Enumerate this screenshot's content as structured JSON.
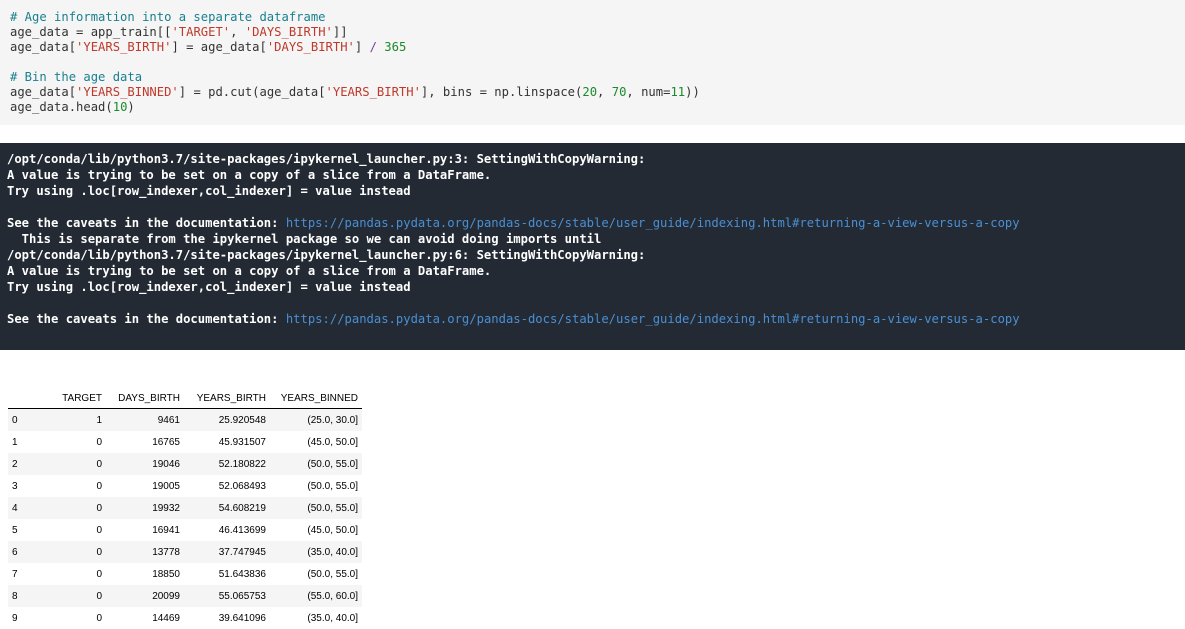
{
  "code_cell": {
    "line1": "# Age information into a separate dataframe",
    "line2_a": "age_data = app_train[[",
    "line2_s1": "'TARGET'",
    "line2_b": ", ",
    "line2_s2": "'DAYS_BIRTH'",
    "line2_c": "]]",
    "line3_a": "age_data[",
    "line3_s1": "'YEARS_BIRTH'",
    "line3_b": "] = age_data[",
    "line3_s2": "'DAYS_BIRTH'",
    "line3_c": "] ",
    "line3_op": "/",
    "line3_num": "365",
    "line5": "# Bin the age data",
    "line6_a": "age_data[",
    "line6_s1": "'YEARS_BINNED'",
    "line6_b": "] = pd.cut(age_data[",
    "line6_s2": "'YEARS_BIRTH'",
    "line6_c": "], bins = np.linspace(",
    "line6_n1": "20",
    "line6_d": ", ",
    "line6_n2": "70",
    "line6_e": ", num=",
    "line6_n3": "11",
    "line6_f": "))",
    "line7_a": "age_data.head(",
    "line7_n": "10",
    "line7_b": ")"
  },
  "stderr": {
    "w1_line1": "/opt/conda/lib/python3.7/site-packages/ipykernel_launcher.py:3: SettingWithCopyWarning:",
    "w1_line2": "A value is trying to be set on a copy of a slice from a DataFrame.",
    "w1_line3": "Try using .loc[row_indexer,col_indexer] = value instead",
    "caveat_prefix": "See the caveats in the documentation: ",
    "caveat_link": "https://pandas.pydata.org/pandas-docs/stable/user_guide/indexing.html#returning-a-view-versus-a-copy",
    "separate_line": "  This is separate from the ipykernel package so we can avoid doing imports until",
    "w2_line1": "/opt/conda/lib/python3.7/site-packages/ipykernel_launcher.py:6: SettingWithCopyWarning:",
    "w2_line2": "A value is trying to be set on a copy of a slice from a DataFrame.",
    "w2_line3": "Try using .loc[row_indexer,col_indexer] = value instead"
  },
  "table": {
    "columns": [
      "TARGET",
      "DAYS_BIRTH",
      "YEARS_BIRTH",
      "YEARS_BINNED"
    ],
    "rows": [
      {
        "index": "0",
        "target": "1",
        "days": "9461",
        "years": "25.920548",
        "binned": "(25.0, 30.0]"
      },
      {
        "index": "1",
        "target": "0",
        "days": "16765",
        "years": "45.931507",
        "binned": "(45.0, 50.0]"
      },
      {
        "index": "2",
        "target": "0",
        "days": "19046",
        "years": "52.180822",
        "binned": "(50.0, 55.0]"
      },
      {
        "index": "3",
        "target": "0",
        "days": "19005",
        "years": "52.068493",
        "binned": "(50.0, 55.0]"
      },
      {
        "index": "4",
        "target": "0",
        "days": "19932",
        "years": "54.608219",
        "binned": "(50.0, 55.0]"
      },
      {
        "index": "5",
        "target": "0",
        "days": "16941",
        "years": "46.413699",
        "binned": "(45.0, 50.0]"
      },
      {
        "index": "6",
        "target": "0",
        "days": "13778",
        "years": "37.747945",
        "binned": "(35.0, 40.0]"
      },
      {
        "index": "7",
        "target": "0",
        "days": "18850",
        "years": "51.643836",
        "binned": "(50.0, 55.0]"
      },
      {
        "index": "8",
        "target": "0",
        "days": "20099",
        "years": "55.065753",
        "binned": "(55.0, 60.0]"
      },
      {
        "index": "9",
        "target": "0",
        "days": "14469",
        "years": "39.641096",
        "binned": "(35.0, 40.0]"
      }
    ]
  }
}
